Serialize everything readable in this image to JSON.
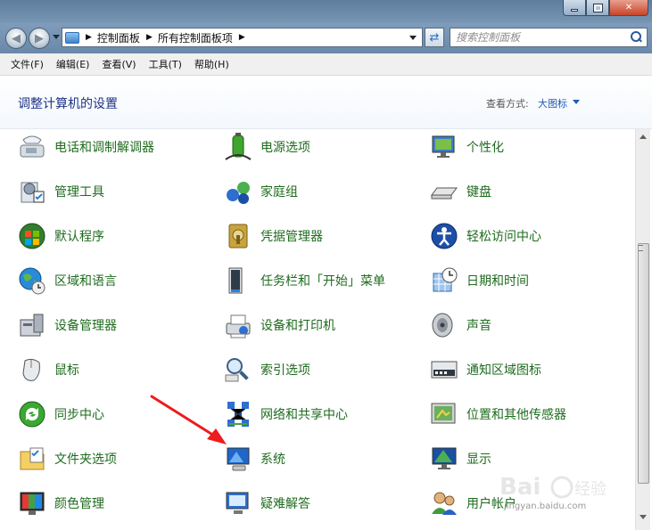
{
  "window": {
    "breadcrumb": [
      "控制面板",
      "所有控制面板项"
    ],
    "search_placeholder": "搜索控制面板"
  },
  "menu": [
    "文件(F)",
    "编辑(E)",
    "查看(V)",
    "工具(T)",
    "帮助(H)"
  ],
  "page_title": "调整计算机的设置",
  "view_by_label": "查看方式:",
  "view_by_value": "大图标",
  "items": [
    {
      "label": "电话和调制解调器",
      "icon": "phone-modem-icon"
    },
    {
      "label": "电源选项",
      "icon": "power-options-icon"
    },
    {
      "label": "个性化",
      "icon": "personalization-icon"
    },
    {
      "label": "管理工具",
      "icon": "admin-tools-icon"
    },
    {
      "label": "家庭组",
      "icon": "homegroup-icon"
    },
    {
      "label": "键盘",
      "icon": "keyboard-icon"
    },
    {
      "label": "默认程序",
      "icon": "default-programs-icon"
    },
    {
      "label": "凭据管理器",
      "icon": "credential-manager-icon"
    },
    {
      "label": "轻松访问中心",
      "icon": "ease-of-access-icon"
    },
    {
      "label": "区域和语言",
      "icon": "region-language-icon"
    },
    {
      "label": "任务栏和「开始」菜单",
      "icon": "taskbar-start-icon"
    },
    {
      "label": "日期和时间",
      "icon": "date-time-icon"
    },
    {
      "label": "设备管理器",
      "icon": "device-manager-icon"
    },
    {
      "label": "设备和打印机",
      "icon": "devices-printers-icon"
    },
    {
      "label": "声音",
      "icon": "sound-icon"
    },
    {
      "label": "鼠标",
      "icon": "mouse-icon"
    },
    {
      "label": "索引选项",
      "icon": "indexing-options-icon"
    },
    {
      "label": "通知区域图标",
      "icon": "notification-area-icon"
    },
    {
      "label": "同步中心",
      "icon": "sync-center-icon"
    },
    {
      "label": "网络和共享中心",
      "icon": "network-sharing-icon"
    },
    {
      "label": "位置和其他传感器",
      "icon": "location-sensors-icon"
    },
    {
      "label": "文件夹选项",
      "icon": "folder-options-icon"
    },
    {
      "label": "系统",
      "icon": "system-icon"
    },
    {
      "label": "显示",
      "icon": "display-icon"
    },
    {
      "label": "颜色管理",
      "icon": "color-management-icon"
    },
    {
      "label": "疑难解答",
      "icon": "troubleshooting-icon"
    },
    {
      "label": "用户帐户",
      "icon": "user-accounts-icon"
    }
  ],
  "watermark": "jingyan.baidu.com",
  "colors": {
    "link_green": "#1e6b1e",
    "title_blue": "#1e3287",
    "annotation_red": "#ee1c1c"
  }
}
